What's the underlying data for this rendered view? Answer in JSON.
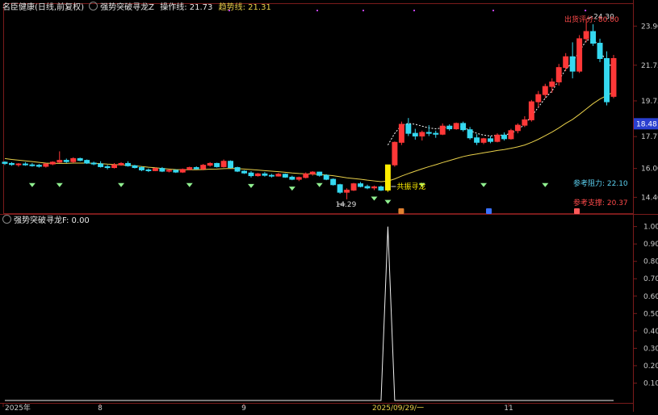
{
  "header": {
    "stock_name": "名臣健康(日线,前复权)",
    "indicator_name": "强势突破寻龙Z",
    "op_line_label": "操作线:",
    "op_line_value": "21.73",
    "trend_line_label": "趋势线:",
    "trend_line_value": "21.31"
  },
  "sub_header": {
    "indicator_name": "强势突破寻龙F",
    "value_text": ": 0.00"
  },
  "price_axis": {
    "ticks": [
      "23.90",
      "21.73",
      "19.75",
      "17.77",
      "16.00",
      "14.40"
    ],
    "tick_values": [
      23.9,
      21.73,
      19.75,
      17.77,
      16.0,
      14.4
    ],
    "range": [
      13.7,
      24.9
    ],
    "current_price": "18.48"
  },
  "annotations": {
    "high_label": "24.30",
    "low_label": "14.29",
    "signal_label": "共振寻龙",
    "shipment_label": "出货评分: 80.00",
    "resistance_label": "参考阻力: 22.10",
    "support_label": "参考支撑: 20.37"
  },
  "sub_axis": {
    "ticks": [
      "1.00",
      "0.90",
      "0.80",
      "0.70",
      "0.60",
      "0.50",
      "0.40",
      "0.30",
      "0.20",
      "0.10"
    ],
    "tick_values": [
      1.0,
      0.9,
      0.8,
      0.7,
      0.6,
      0.5,
      0.4,
      0.3,
      0.2,
      0.1
    ],
    "range": [
      0,
      1.04
    ]
  },
  "date_axis": {
    "labels": [
      "2025年",
      "8",
      "9",
      "2025/09/29/一",
      "11"
    ]
  },
  "colors": {
    "up": "#ff3838",
    "down": "#35d8f0",
    "ma": "#e8d04a",
    "dashed": "#ffffff",
    "signal": "#ffee00",
    "triangle": "#90f090",
    "label_cyan": "#5bd0f0",
    "label_red": "#ff4a4a",
    "axis_bg": "#2a3fd0"
  },
  "chart_data": [
    {
      "type": "candlestick",
      "title": "强势突破寻龙Z",
      "candles": [
        [
          16.35,
          16.4,
          16.2,
          16.28
        ],
        [
          16.28,
          16.35,
          16.15,
          16.22
        ],
        [
          16.22,
          16.3,
          16.1,
          16.25
        ],
        [
          16.25,
          16.35,
          16.15,
          16.2
        ],
        [
          16.2,
          16.3,
          16.1,
          16.18
        ],
        [
          16.18,
          16.25,
          16.05,
          16.12
        ],
        [
          16.12,
          16.3,
          16.05,
          16.25
        ],
        [
          16.25,
          16.4,
          16.18,
          16.35
        ],
        [
          16.35,
          16.95,
          16.3,
          16.45
        ],
        [
          16.45,
          16.55,
          16.3,
          16.38
        ],
        [
          16.38,
          16.62,
          16.3,
          16.55
        ],
        [
          16.55,
          16.6,
          16.4,
          16.45
        ],
        [
          16.45,
          16.5,
          16.25,
          16.3
        ],
        [
          16.3,
          16.38,
          16.18,
          16.25
        ],
        [
          16.25,
          16.4,
          16.05,
          16.1
        ],
        [
          16.1,
          16.2,
          15.95,
          16.05
        ],
        [
          16.05,
          16.3,
          16.0,
          16.2
        ],
        [
          16.2,
          16.35,
          16.15,
          16.28
        ],
        [
          16.28,
          16.4,
          16.1,
          16.15
        ],
        [
          16.15,
          16.2,
          16.0,
          16.05
        ],
        [
          16.05,
          16.12,
          15.85,
          15.92
        ],
        [
          15.92,
          16.0,
          15.8,
          15.88
        ],
        [
          15.88,
          16.05,
          15.85,
          16.0
        ],
        [
          16.0,
          16.08,
          15.8,
          15.85
        ],
        [
          15.85,
          15.95,
          15.78,
          15.9
        ],
        [
          15.9,
          15.95,
          15.75,
          15.8
        ],
        [
          15.8,
          16.0,
          15.75,
          15.95
        ],
        [
          15.95,
          16.1,
          15.9,
          16.05
        ],
        [
          16.05,
          16.12,
          15.95,
          15.98
        ],
        [
          15.98,
          16.25,
          15.9,
          16.18
        ],
        [
          16.18,
          16.35,
          16.1,
          16.28
        ],
        [
          16.28,
          16.32,
          16.05,
          16.1
        ],
        [
          16.1,
          16.5,
          16.05,
          16.4
        ],
        [
          16.4,
          16.45,
          16.0,
          16.05
        ],
        [
          16.05,
          16.1,
          15.8,
          15.85
        ],
        [
          15.85,
          15.9,
          15.7,
          15.75
        ],
        [
          15.75,
          15.85,
          15.5,
          15.6
        ],
        [
          15.6,
          15.75,
          15.55,
          15.7
        ],
        [
          15.7,
          15.8,
          15.55,
          15.62
        ],
        [
          15.62,
          15.7,
          15.5,
          15.58
        ],
        [
          15.58,
          15.75,
          15.55,
          15.68
        ],
        [
          15.68,
          15.72,
          15.48,
          15.52
        ],
        [
          15.52,
          15.6,
          15.35,
          15.4
        ],
        [
          15.4,
          15.55,
          15.3,
          15.5
        ],
        [
          15.5,
          15.78,
          15.45,
          15.7
        ],
        [
          15.7,
          15.85,
          15.6,
          15.8
        ],
        [
          15.8,
          15.82,
          15.55,
          15.62
        ],
        [
          15.62,
          15.68,
          15.35,
          15.4
        ],
        [
          15.4,
          15.45,
          15.05,
          15.1
        ],
        [
          15.1,
          15.15,
          14.6,
          14.68
        ],
        [
          14.68,
          14.9,
          14.29,
          14.8
        ],
        [
          14.8,
          15.2,
          14.75,
          15.15
        ],
        [
          15.15,
          15.25,
          14.95,
          15.0
        ],
        [
          15.0,
          15.1,
          14.85,
          14.92
        ],
        [
          14.92,
          15.05,
          14.8,
          14.98
        ],
        [
          14.98,
          15.05,
          14.75,
          14.8
        ],
        [
          14.8,
          16.2,
          14.7,
          16.2
        ],
        [
          16.2,
          17.5,
          16.1,
          17.45
        ],
        [
          17.45,
          18.6,
          17.3,
          18.45
        ],
        [
          18.45,
          18.8,
          17.8,
          17.95
        ],
        [
          17.95,
          18.2,
          17.6,
          17.8
        ],
        [
          17.8,
          18.1,
          17.55,
          18.0
        ],
        [
          18.0,
          18.4,
          17.8,
          17.95
        ],
        [
          17.95,
          18.1,
          17.7,
          17.9
        ],
        [
          17.9,
          18.5,
          17.85,
          18.35
        ],
        [
          18.35,
          18.45,
          18.1,
          18.2
        ],
        [
          18.2,
          18.55,
          18.15,
          18.5
        ],
        [
          18.5,
          18.6,
          18.05,
          18.15
        ],
        [
          18.15,
          18.3,
          17.6,
          17.7
        ],
        [
          17.7,
          17.9,
          17.3,
          17.45
        ],
        [
          17.45,
          17.7,
          17.35,
          17.65
        ],
        [
          17.65,
          17.8,
          17.4,
          17.5
        ],
        [
          17.5,
          17.95,
          17.45,
          17.85
        ],
        [
          17.85,
          18.0,
          17.55,
          17.65
        ],
        [
          17.65,
          18.2,
          17.6,
          18.1
        ],
        [
          18.1,
          18.5,
          17.95,
          18.4
        ],
        [
          18.4,
          18.9,
          18.3,
          18.7
        ],
        [
          18.7,
          19.8,
          18.6,
          19.7
        ],
        [
          19.7,
          20.3,
          19.4,
          20.1
        ],
        [
          20.1,
          20.7,
          19.9,
          20.55
        ],
        [
          20.55,
          21.0,
          20.2,
          20.8
        ],
        [
          20.8,
          21.8,
          20.6,
          21.6
        ],
        [
          21.6,
          22.4,
          21.4,
          22.2
        ],
        [
          22.2,
          23.0,
          21.0,
          21.4
        ],
        [
          21.4,
          23.4,
          21.3,
          23.2
        ],
        [
          23.2,
          24.3,
          23.0,
          23.6
        ],
        [
          23.6,
          24.0,
          22.8,
          22.95
        ],
        [
          22.95,
          23.2,
          21.9,
          22.1
        ],
        [
          22.1,
          22.5,
          19.5,
          19.7
        ],
        [
          20.0,
          22.3,
          19.9,
          22.1
        ]
      ],
      "ma_series_name": "趋势线",
      "ma": [
        16.55,
        16.5,
        16.46,
        16.42,
        16.38,
        16.34,
        16.3,
        16.28,
        16.28,
        16.28,
        16.3,
        16.3,
        16.3,
        16.29,
        16.27,
        16.24,
        16.22,
        16.2,
        16.18,
        16.15,
        16.11,
        16.07,
        16.04,
        16.0,
        15.97,
        15.94,
        15.93,
        15.93,
        15.93,
        15.94,
        15.96,
        15.97,
        15.99,
        16.0,
        15.99,
        15.97,
        15.94,
        15.91,
        15.88,
        15.85,
        15.82,
        15.79,
        15.75,
        15.72,
        15.7,
        15.69,
        15.67,
        15.64,
        15.6,
        15.54,
        15.48,
        15.44,
        15.4,
        15.35,
        15.31,
        15.27,
        15.3,
        15.42,
        15.58,
        15.72,
        15.85,
        15.98,
        16.1,
        16.21,
        16.33,
        16.44,
        16.55,
        16.66,
        16.74,
        16.8,
        16.87,
        16.93,
        17.0,
        17.05,
        17.12,
        17.2,
        17.3,
        17.45,
        17.62,
        17.82,
        18.02,
        18.25,
        18.5,
        18.72,
        19.0,
        19.3,
        19.6,
        19.85,
        20.05,
        20.25
      ],
      "op_series_name": "操作线",
      "op_line": [
        56,
        17.3,
        57,
        17.95,
        58,
        18.4,
        59,
        18.5,
        60,
        18.45,
        61,
        18.35,
        62,
        18.25,
        63,
        18.2,
        64,
        18.25,
        65,
        18.3,
        66,
        18.35,
        67,
        18.3,
        68,
        18.1,
        69,
        17.95,
        70,
        17.85,
        71,
        17.8,
        72,
        17.85,
        73,
        17.85,
        74,
        17.95,
        75,
        18.15,
        76,
        18.45,
        77,
        18.9,
        78,
        19.4,
        79,
        19.9,
        80,
        20.3,
        81,
        20.9,
        82,
        21.5,
        83,
        21.9,
        84,
        22.5,
        85,
        23.1,
        86,
        23.2,
        87,
        22.7,
        88,
        21.73,
        89,
        21.73
      ],
      "signal_bar_index": 56,
      "triangle_indices": [
        4,
        8,
        17,
        27,
        36,
        42,
        46,
        54,
        61,
        70,
        79
      ],
      "triangle_level": 15.55
    },
    {
      "type": "line",
      "title": "强势突破寻龙F",
      "x_count": 90,
      "values_note_index": 56,
      "values": [
        0,
        0,
        0,
        0,
        0,
        0,
        0,
        0,
        0,
        0,
        0,
        0,
        0,
        0,
        0,
        0,
        0,
        0,
        0,
        0,
        0,
        0,
        0,
        0,
        0,
        0,
        0,
        0,
        0,
        0,
        0,
        0,
        0,
        0,
        0,
        0,
        0,
        0,
        0,
        0,
        0,
        0,
        0,
        0,
        0,
        0,
        0,
        0,
        0,
        0,
        0,
        0,
        0,
        0,
        0,
        0,
        1,
        0,
        0,
        0,
        0,
        0,
        0,
        0,
        0,
        0,
        0,
        0,
        0,
        0,
        0,
        0,
        0,
        0,
        0,
        0,
        0,
        0,
        0,
        0,
        0,
        0,
        0,
        0,
        0,
        0,
        0,
        0,
        0,
        0
      ],
      "ylim": [
        0,
        1.04
      ]
    }
  ]
}
